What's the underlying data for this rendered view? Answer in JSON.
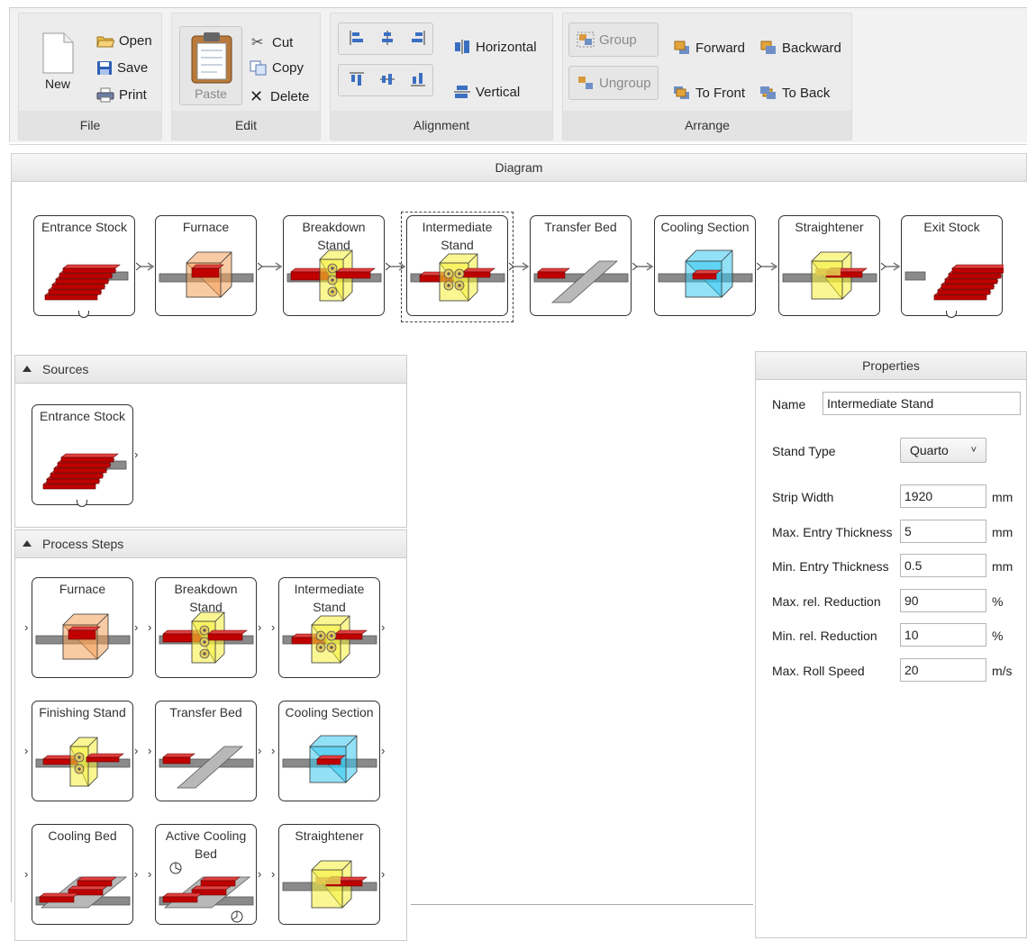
{
  "ribbon": {
    "file": {
      "label": "File",
      "new": "New",
      "open": "Open",
      "save": "Save",
      "print": "Print"
    },
    "edit": {
      "label": "Edit",
      "paste": "Paste",
      "cut": "Cut",
      "copy": "Copy",
      "delete": "Delete"
    },
    "alignment": {
      "label": "Alignment",
      "horizontal": "Horizontal",
      "vertical": "Vertical"
    },
    "arrange": {
      "label": "Arrange",
      "group": "Group",
      "ungroup": "Ungroup",
      "forward": "Forward",
      "backward": "Backward",
      "to_front": "To Front",
      "to_back": "To Back"
    }
  },
  "diagram": {
    "title": "Diagram",
    "nodes": [
      {
        "title1": "Entrance Stock",
        "title2": ""
      },
      {
        "title1": "Furnace",
        "title2": ""
      },
      {
        "title1": "Breakdown",
        "title2": "Stand"
      },
      {
        "title1": "Intermediate",
        "title2": "Stand"
      },
      {
        "title1": "Transfer Bed",
        "title2": ""
      },
      {
        "title1": "Cooling Section",
        "title2": ""
      },
      {
        "title1": "Straightener",
        "title2": ""
      },
      {
        "title1": "Exit Stock",
        "title2": ""
      }
    ]
  },
  "sources": {
    "title": "Sources",
    "items": [
      {
        "title1": "Entrance Stock",
        "title2": ""
      }
    ]
  },
  "process_steps": {
    "title": "Process Steps",
    "items": [
      {
        "title1": "Furnace",
        "title2": ""
      },
      {
        "title1": "Breakdown",
        "title2": "Stand"
      },
      {
        "title1": "Intermediate",
        "title2": "Stand"
      },
      {
        "title1": "Finishing Stand",
        "title2": ""
      },
      {
        "title1": "Transfer Bed",
        "title2": ""
      },
      {
        "title1": "Cooling Section",
        "title2": ""
      },
      {
        "title1": "Cooling Bed",
        "title2": ""
      },
      {
        "title1": "Active Cooling",
        "title2": "Bed"
      },
      {
        "title1": "Straightener",
        "title2": ""
      }
    ]
  },
  "properties": {
    "title": "Properties",
    "name_label": "Name",
    "name_value": "Intermediate Stand",
    "stand_type_label": "Stand Type",
    "stand_type_value": "Quarto",
    "fields": [
      {
        "label": "Strip Width",
        "value": "1920",
        "unit": "mm"
      },
      {
        "label": "Max. Entry Thickness",
        "value": "5",
        "unit": "mm"
      },
      {
        "label": "Min. Entry Thickness",
        "value": "0.5",
        "unit": "mm"
      },
      {
        "label": "Max. rel. Reduction",
        "value": "90",
        "unit": "%"
      },
      {
        "label": "Min. rel. Reduction",
        "value": "10",
        "unit": "%"
      },
      {
        "label": "Max. Roll Speed",
        "value": "20",
        "unit": "m/s"
      }
    ]
  },
  "colors": {
    "stock_red": "#c00000",
    "furnace_orange": "#f4a05a",
    "stand_yellow": "#f5f03a",
    "cooling_cyan": "#38c8f0",
    "rail_gray": "#8a8a8a"
  }
}
